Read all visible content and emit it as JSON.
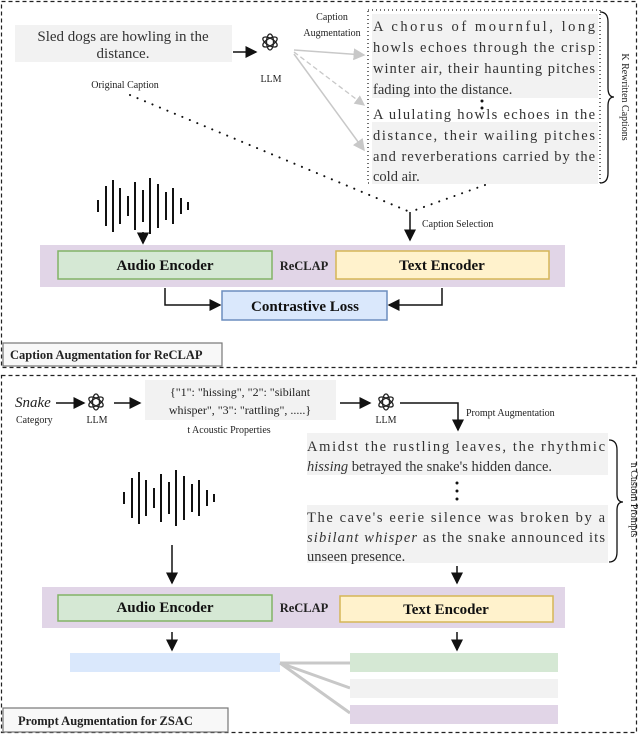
{
  "top_panel": {
    "label": "Caption Augmentation for ReCLAP",
    "original_caption": [
      "Sled dogs are howling in the",
      "distance."
    ],
    "original_caption_label": "Original Caption",
    "llm_label": "LLM",
    "augmentation_label": [
      "Caption",
      "Augmentation"
    ],
    "rewritten_caption_1": [
      "A chorus of mournful, long",
      "howls echoes through the crisp",
      "winter air, their haunting pitches",
      "fading into the distance."
    ],
    "rewritten_caption_2": [
      "A ululating howls echoes in the",
      "distance, their wailing pitches",
      "and reverberations carried by the",
      "cold air."
    ],
    "brace_label": "K Rewritten Captions",
    "selection_label": "Caption Selection",
    "audio_encoder": "Audio Encoder",
    "model_name": "ReCLAP",
    "text_encoder": "Text Encoder",
    "loss": "Contrastive Loss"
  },
  "bottom_panel": {
    "label": "Prompt Augmentation for ZSAC",
    "category_word": "Snake",
    "category_label": "Category",
    "llm_label": "LLM",
    "properties": [
      "{\"1\": \"hissing\", \"2\": \"sibilant",
      "whisper\", \"3\": \"rattling\", .....}"
    ],
    "properties_label": "t Acoustic Properties",
    "augmentation_label": "Prompt Augmentation",
    "prompt_1": {
      "line1": "Amidst the rustling leaves, the rhythmic",
      "italic": "hissing",
      "line2_rest": " betrayed the snake's hidden dance."
    },
    "prompt_2": {
      "line1": "The cave's eerie silence was broken by a",
      "italic": "sibilant whisper",
      "line2_rest": " as the snake announced its",
      "line3": "unseen presence."
    },
    "brace_label": "n Custom Prompts",
    "audio_encoder": "Audio Encoder",
    "model_name": "ReCLAP",
    "text_encoder": "Text Encoder"
  },
  "colors": {
    "band": "#e1d5e7",
    "audio_fill": "#d5e8d4",
    "audio_stroke": "#82b366",
    "text_fill": "#fff2cc",
    "text_stroke": "#d6b656",
    "loss_fill": "#dae8fc",
    "loss_stroke": "#6c8ebf",
    "caption_bg": "#f2f2f2"
  }
}
